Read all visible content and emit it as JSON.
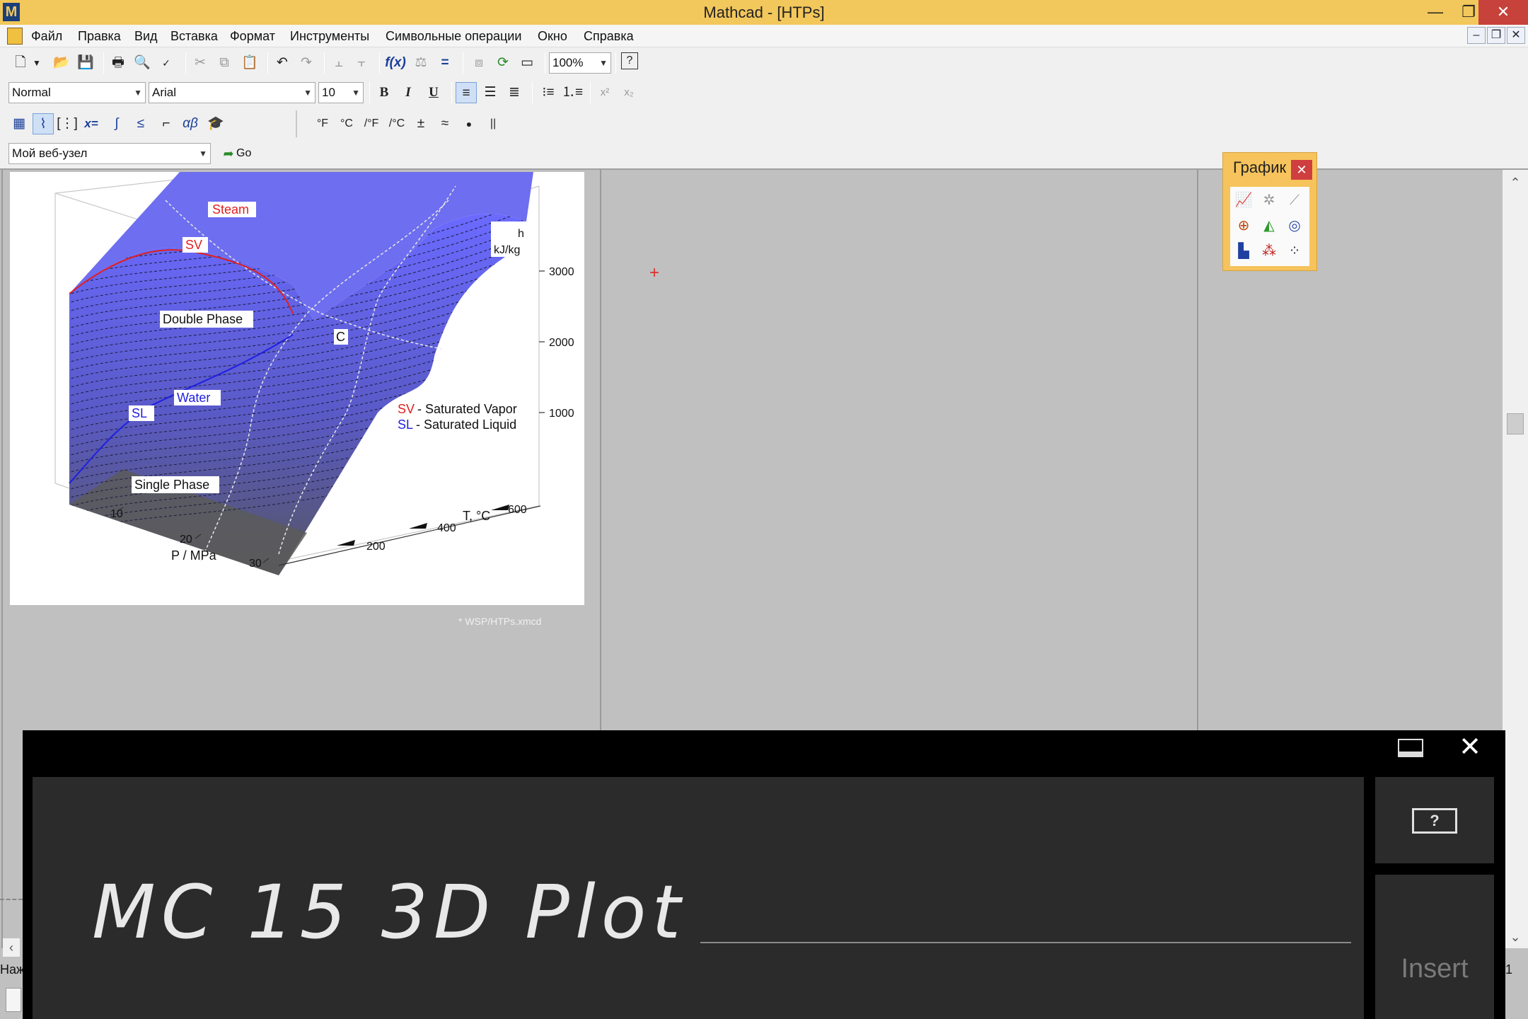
{
  "window": {
    "title": "Mathcad - [HTPs]",
    "minimize_glyph": "—",
    "restore_glyph": "❐",
    "close_glyph": "✕"
  },
  "menu": {
    "items": [
      "Файл",
      "Правка",
      "Вид",
      "Вставка",
      "Формат",
      "Инструменты",
      "Символьные операции",
      "Окно",
      "Справка"
    ],
    "mdi_minimize": "–",
    "mdi_restore": "❐",
    "mdi_close": "✕"
  },
  "toolbar": {
    "zoom": "100%",
    "style": "Normal",
    "font": "Arial",
    "size": "10",
    "bold": "B",
    "italic": "I",
    "underline": "U",
    "units": [
      "°F",
      "°C",
      "/°F",
      "/°C",
      "±",
      "≈",
      "●",
      "||"
    ],
    "web_address": "Мой веб-узел",
    "go_label": "Go"
  },
  "palette": {
    "title": "График",
    "close": "✕"
  },
  "chart_data": {
    "type": "surface3d",
    "xlabel": "P / MPa",
    "ylabel": "T, °C",
    "zlabel": "h\nkJ/kg",
    "x_ticks": [
      10,
      20,
      30
    ],
    "y_ticks": [
      200,
      400,
      600
    ],
    "z_ticks": [
      1000,
      2000,
      3000
    ],
    "annotations": [
      "Steam",
      "SV",
      "Double Phase",
      "C",
      "Water",
      "SL",
      "Single Phase"
    ],
    "legend": [
      {
        "key": "SV",
        "text": "- Saturated Vapor",
        "color": "#e02020"
      },
      {
        "key": "SL",
        "text": "- Saturated Liquid",
        "color": "#2020e0"
      }
    ],
    "colors": {
      "surface_top": "#6a6aff",
      "surface_bottom": "#505050",
      "sv_curve": "#e02020",
      "sl_curve": "#2020e0"
    }
  },
  "document": {
    "footnote": "* WSP/HTPs.xmcd"
  },
  "handwriting": {
    "text": "MC 15 3D Plot",
    "insert_label": "Insert",
    "help_label": "?"
  },
  "status": {
    "left": "Наж",
    "right": "1"
  }
}
